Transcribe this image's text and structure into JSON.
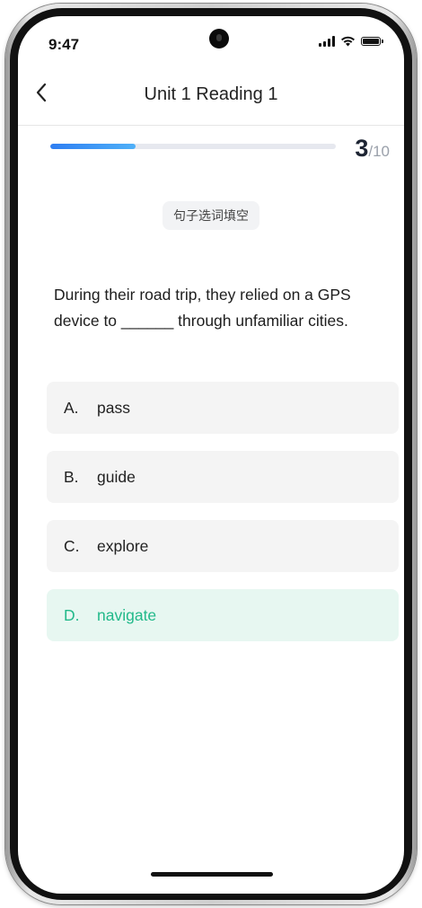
{
  "status_bar": {
    "time": "9:47",
    "icons": [
      "signal-icon",
      "wifi-icon",
      "battery-icon"
    ]
  },
  "nav": {
    "back_icon": "chevron-left-icon",
    "title": "Unit 1 Reading 1"
  },
  "progress": {
    "current": "3",
    "total": "/10",
    "fraction": 0.3,
    "colors": {
      "start": "#2e7ef2",
      "end": "#4fb0f8",
      "track": "#e6e8ef"
    }
  },
  "question": {
    "type_label": "句子选词填空",
    "text": "During their road trip, they relied on a GPS device to ______ through unfamiliar cities."
  },
  "options": [
    {
      "letter": "A.",
      "text": "pass",
      "selected": false
    },
    {
      "letter": "B.",
      "text": "guide",
      "selected": false
    },
    {
      "letter": "C.",
      "text": "explore",
      "selected": false
    },
    {
      "letter": "D.",
      "text": "navigate",
      "selected": true
    }
  ],
  "colors": {
    "selected_text": "#22b98a",
    "selected_bg": "#e7f7f1",
    "option_bg": "#f4f4f4"
  }
}
